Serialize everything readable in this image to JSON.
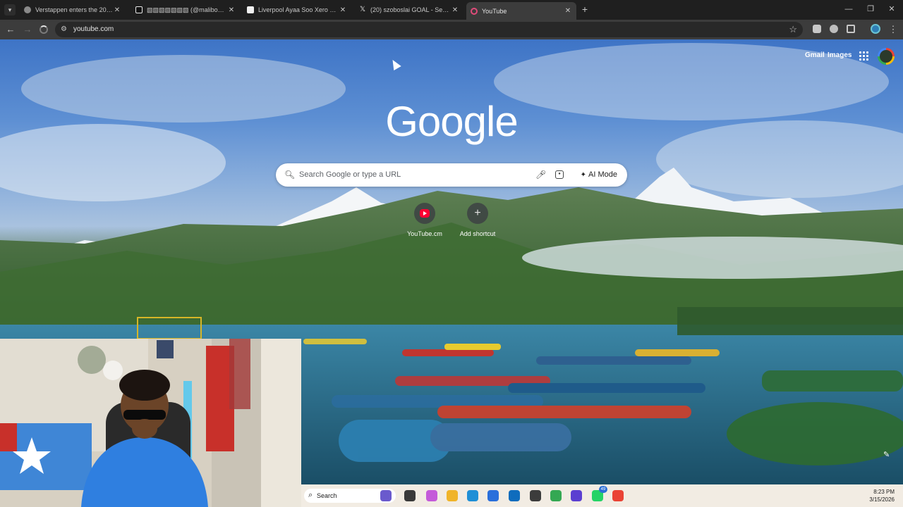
{
  "tabs": [
    {
      "title": "Verstappen enters the 2026 se",
      "favicon": "globe-icon",
      "active": false
    },
    {
      "title": "▧▧▧▧▧▧▧ (@maliboy12) is",
      "favicon": "tiktok-icon",
      "active": false
    },
    {
      "title": "Liverpool Ayaa Soo Xero Galise",
      "favicon": "video-icon",
      "active": false
    },
    {
      "title": "(20) szoboslai GOAL - Search /",
      "favicon": "x-icon",
      "active": false
    },
    {
      "title": "YouTube",
      "favicon": "loading-icon",
      "active": true
    }
  ],
  "toolbar": {
    "url": "youtube.com"
  },
  "ntp": {
    "top_links": {
      "gmail": "Gmail",
      "images": "Images"
    },
    "logo": "Google",
    "search_placeholder": "Search Google or type a URL",
    "ai_mode_label": "AI Mode",
    "shortcuts": [
      {
        "label": "YouTube.cm",
        "icon": "youtube-icon"
      },
      {
        "label": "Add shortcut",
        "icon": "plus-icon"
      }
    ]
  },
  "taskbar": {
    "search_label": "Search",
    "apps": [
      {
        "name": "widgets-icon",
        "color": "#6a5acd"
      },
      {
        "name": "task-view-icon",
        "color": "#3a3a3a"
      },
      {
        "name": "copilot-icon",
        "color": "#c45ad9"
      },
      {
        "name": "file-explorer-icon",
        "color": "#f0b429"
      },
      {
        "name": "edge-icon",
        "color": "#1f8fd6"
      },
      {
        "name": "store-icon",
        "color": "#2a6fdb"
      },
      {
        "name": "outlook-icon",
        "color": "#0f6cbd"
      },
      {
        "name": "app-icon",
        "color": "#3c3c3c"
      },
      {
        "name": "chrome-icon",
        "color": "#34a853"
      },
      {
        "name": "opera-icon",
        "color": "#5b3fd1"
      },
      {
        "name": "whatsapp-icon",
        "color": "#25d366",
        "badge": "49"
      },
      {
        "name": "chrome-alt-icon",
        "color": "#ea4335"
      }
    ],
    "time": "8:23 PM",
    "date": "3/15/2026"
  }
}
